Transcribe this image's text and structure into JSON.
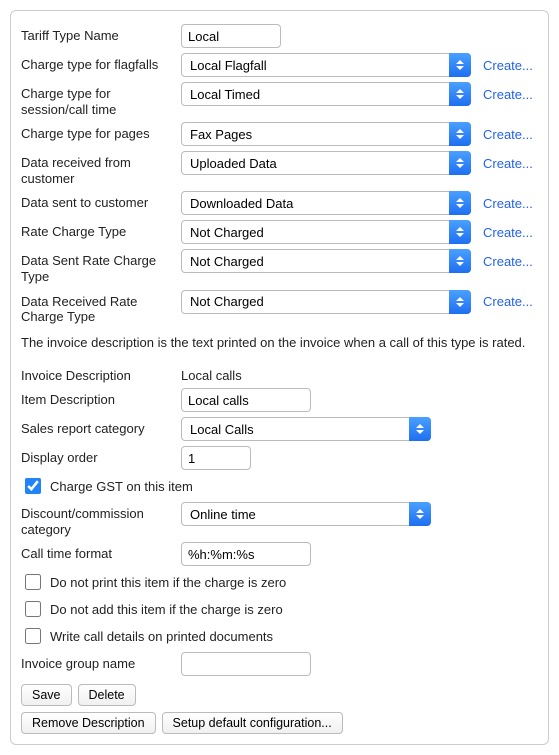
{
  "fields": {
    "tariff_type_name": {
      "label": "Tariff Type Name",
      "value": "Local"
    },
    "charge_flagfall": {
      "label": "Charge type for flagfalls",
      "value": "Local Flagfall",
      "create": "Create..."
    },
    "charge_session": {
      "label": "Charge type for session/call time",
      "value": "Local Timed",
      "create": "Create..."
    },
    "charge_pages": {
      "label": "Charge type for pages",
      "value": "Fax Pages",
      "create": "Create..."
    },
    "data_received": {
      "label": "Data received from customer",
      "value": "Uploaded Data",
      "create": "Create..."
    },
    "data_sent": {
      "label": "Data sent to customer",
      "value": "Downloaded Data",
      "create": "Create..."
    },
    "rate_charge": {
      "label": "Rate Charge Type",
      "value": "Not Charged",
      "create": "Create..."
    },
    "data_sent_rate": {
      "label": "Data Sent Rate Charge Type",
      "value": "Not Charged",
      "create": "Create..."
    },
    "data_received_rate": {
      "label": "Data Received Rate Charge Type",
      "value": "Not Charged",
      "create": "Create..."
    },
    "invoice_desc": {
      "label": "Invoice Description",
      "value": "Local calls"
    },
    "item_desc": {
      "label": "Item Description",
      "value": "Local calls"
    },
    "sales_cat": {
      "label": "Sales report category",
      "value": "Local Calls"
    },
    "display_order": {
      "label": "Display order",
      "value": "1"
    },
    "charge_gst": {
      "label": "Charge GST on this item",
      "checked": true
    },
    "discount_cat": {
      "label": "Discount/commission category",
      "value": "Online time"
    },
    "call_time_fmt": {
      "label": "Call time format",
      "value": "%h:%m:%s"
    },
    "no_print_zero": {
      "label": "Do not print this item if the charge is zero",
      "checked": false
    },
    "no_add_zero": {
      "label": "Do not add this item if the charge is zero",
      "checked": false
    },
    "write_details": {
      "label": "Write call details on printed documents",
      "checked": false
    },
    "invoice_group": {
      "label": "Invoice group name",
      "value": ""
    }
  },
  "help_text": "The invoice description is the text printed on the invoice when a call of this type is rated.",
  "buttons": {
    "save": "Save",
    "delete": "Delete",
    "remove_desc": "Remove Description",
    "setup_default": "Setup default configuration..."
  }
}
